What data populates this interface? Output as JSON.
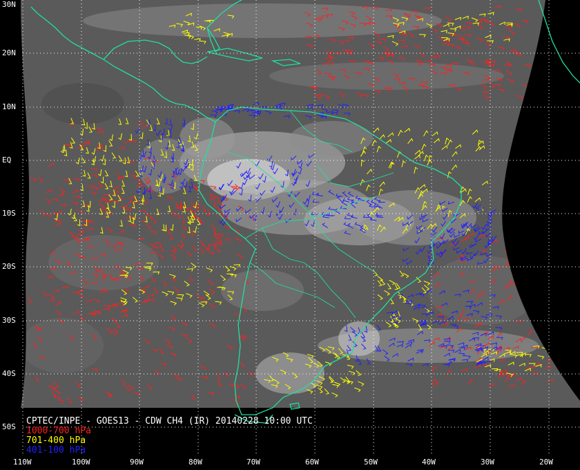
{
  "caption": {
    "title": "CPTEC/INPE - GOES13 - CDW CH4 (IR) 20140228 10:00 UTC",
    "legend": [
      {
        "label": "1000-700 hPa",
        "color": "#ff2020"
      },
      {
        "label": "701-400 hPa",
        "color": "#ffff00"
      },
      {
        "label": "401-100 hPa",
        "color": "#2020ff"
      }
    ]
  },
  "lat_labels": [
    "30N",
    "20N",
    "10N",
    "EQ",
    "10S",
    "20S",
    "30S",
    "40S",
    "50S"
  ],
  "lon_labels": [
    "110W",
    "100W",
    "90W",
    "80W",
    "70W",
    "60W",
    "50W",
    "40W",
    "30W",
    "20W"
  ],
  "colors": {
    "coast": "#1fe0a0",
    "grid": "#ffffff",
    "background": "#000000",
    "text": "#ffffff"
  }
}
